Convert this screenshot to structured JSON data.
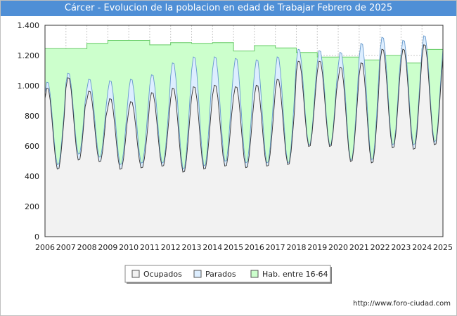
{
  "chart_data": {
    "type": "area",
    "title": "Cárcer - Evolucion de la poblacion en edad de Trabajar Febrero de 2025",
    "x_labels": [
      "2006",
      "2007",
      "2008",
      "2009",
      "2010",
      "2011",
      "2012",
      "2013",
      "2014",
      "2015",
      "2016",
      "2017",
      "2018",
      "2019",
      "2020",
      "2021",
      "2022",
      "2023",
      "2024",
      "2025"
    ],
    "y_ticks": [
      0,
      200,
      400,
      600,
      800,
      "1.000",
      "1.200",
      "1.400"
    ],
    "ylim": [
      0,
      1400
    ],
    "xlim": [
      2006,
      2025
    ],
    "grid": true,
    "legend_position": "bottom",
    "series": [
      {
        "name": "Hab. entre 16-64",
        "color": "#ccffcc",
        "stroke": "#66cc66",
        "values": [
          {
            "year": 2006,
            "value": 1245
          },
          {
            "year": 2007,
            "value": 1245
          },
          {
            "year": 2008,
            "value": 1280
          },
          {
            "year": 2009,
            "value": 1300
          },
          {
            "year": 2010,
            "value": 1300
          },
          {
            "year": 2011,
            "value": 1270
          },
          {
            "year": 2012,
            "value": 1285
          },
          {
            "year": 2013,
            "value": 1280
          },
          {
            "year": 2014,
            "value": 1285
          },
          {
            "year": 2015,
            "value": 1230
          },
          {
            "year": 2016,
            "value": 1265
          },
          {
            "year": 2017,
            "value": 1250
          },
          {
            "year": 2018,
            "value": 1220
          },
          {
            "year": 2019,
            "value": 1190
          },
          {
            "year": 2020,
            "value": 1190
          },
          {
            "year": 2021,
            "value": 1170
          },
          {
            "year": 2022,
            "value": 1200
          },
          {
            "year": 2023,
            "value": 1150
          },
          {
            "year": 2024,
            "value": 1240
          }
        ]
      },
      {
        "name": "Parados",
        "color": "#ddeeff",
        "stroke": "#6699cc",
        "peaks": [
          1030,
          1090,
          1050,
          1040,
          1050,
          1080,
          1160,
          1200,
          1200,
          1190,
          1180,
          1200,
          1250,
          1240,
          1230,
          1290,
          1330,
          1310,
          1340
        ],
        "troughs": [
          470,
          540,
          520,
          470,
          480,
          480,
          440,
          460,
          490,
          480,
          480,
          480,
          600,
          600,
          500,
          500,
          600,
          600,
          620
        ]
      },
      {
        "name": "Ocupados",
        "color": "#f2f2f2",
        "stroke": "#333333",
        "peaks": [
          990,
          1060,
          970,
          920,
          900,
          960,
          990,
          1000,
          1010,
          1000,
          1010,
          1050,
          1170,
          1170,
          1130,
          1160,
          1250,
          1250,
          1280
        ],
        "troughs": [
          440,
          500,
          490,
          440,
          450,
          460,
          420,
          440,
          460,
          450,
          460,
          470,
          590,
          590,
          490,
          480,
          580,
          570,
          600
        ]
      }
    ]
  },
  "footer": {
    "source": "http://www.foro-ciudad.com"
  }
}
